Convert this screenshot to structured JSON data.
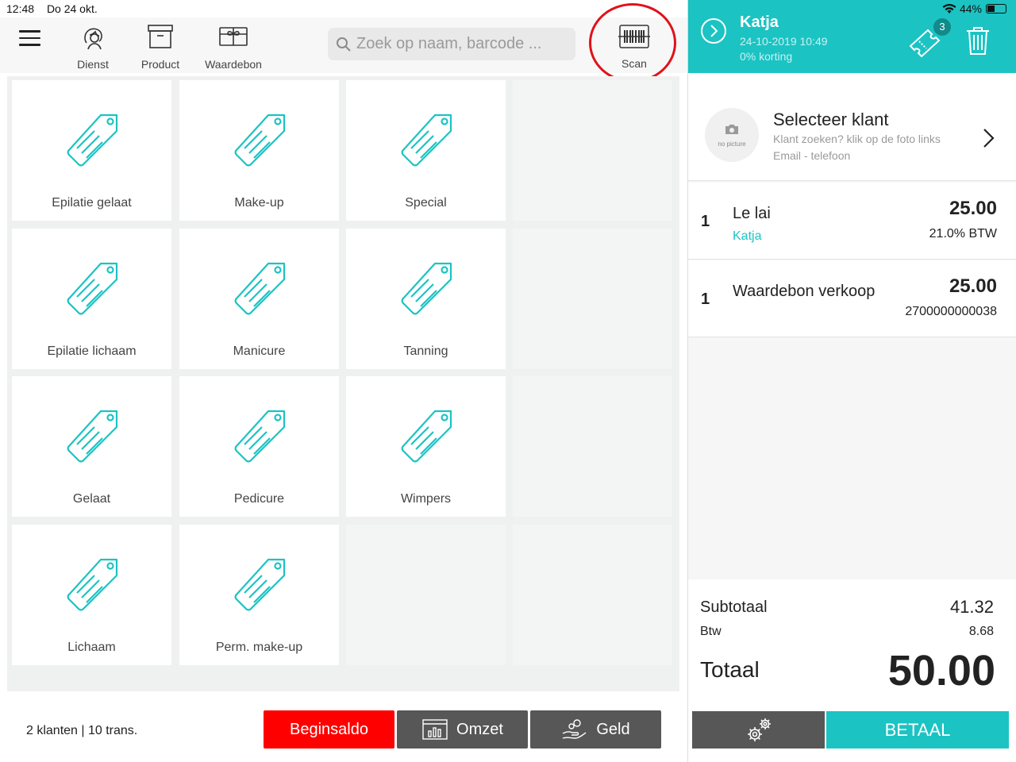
{
  "status": {
    "time": "12:48",
    "date": "Do 24 okt.",
    "battery": "44%"
  },
  "toolbar": {
    "menu_icon": "hamburger-icon",
    "items": [
      {
        "label": "Dienst",
        "icon": "hair-person-icon"
      },
      {
        "label": "Product",
        "icon": "box-icon"
      },
      {
        "label": "Waardebon",
        "icon": "gift-card-icon"
      }
    ],
    "search_placeholder": "Zoek op naam, barcode ...",
    "scan_label": "Scan",
    "scan_icon": "barcode-icon"
  },
  "categories": [
    "Epilatie gelaat",
    "Make-up",
    "Special",
    "Epilatie lichaam",
    "Manicure",
    "Tanning",
    "Gelaat",
    "Pedicure",
    "Wimpers",
    "Lichaam",
    "Perm. make-up"
  ],
  "footer": {
    "stats": "2 klanten | 10 trans.",
    "begin_label": "Beginsaldo",
    "omzet_label": "Omzet",
    "geld_label": "Geld"
  },
  "order": {
    "employee": "Katja",
    "datetime": "24-10-2019 10:49",
    "discount": "0% korting",
    "voucher_count": "3",
    "customer": {
      "title": "Selecteer klant",
      "hint": "Klant zoeken? klik op de foto links",
      "sub": "Email - telefoon",
      "no_picture": "no picture"
    },
    "lines": [
      {
        "qty": "1",
        "title": "Le lai",
        "sub": "Katja",
        "price": "25.00",
        "meta": "21.0% BTW"
      },
      {
        "qty": "1",
        "title": "Waardebon verkoop",
        "sub": "",
        "price": "25.00",
        "meta": "2700000000038"
      }
    ],
    "subtotal_label": "Subtotaal",
    "subtotal": "41.32",
    "btw_label": "Btw",
    "btw": "8.68",
    "total_label": "Totaal",
    "total": "50.00",
    "pay_label": "BETAAL"
  },
  "colors": {
    "accent": "#1cc3c3",
    "danger": "#ff0000",
    "dark_button": "#575757",
    "highlight_circle": "#e0121a"
  }
}
